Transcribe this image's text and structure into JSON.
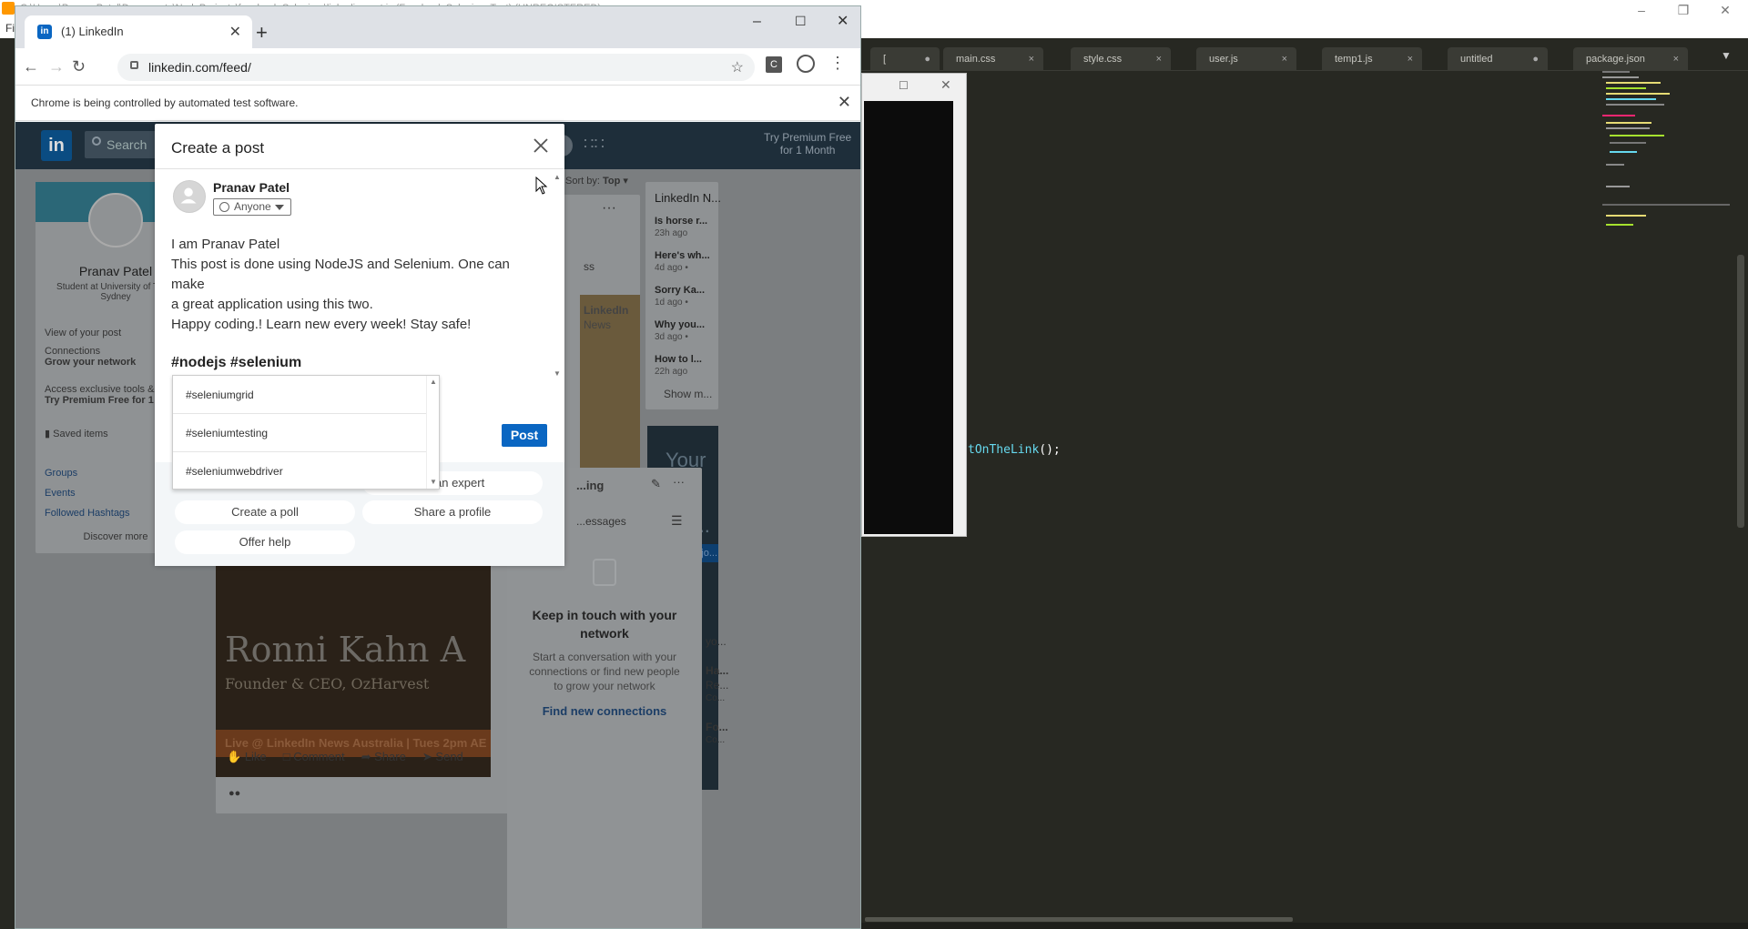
{
  "sublime": {
    "title": "C:\\Users\\Pranav Patel\\Documents\\NodeProjects\\facebook-Selenium\\linkedin-post.js (Facebook Selenium Test) (UNREGISTERED)",
    "menu_letter": "Fi",
    "tabs": [
      {
        "label": "[",
        "close": "●"
      },
      {
        "label": "main.css",
        "close": "×"
      },
      {
        "label": "style.css",
        "close": "×"
      },
      {
        "label": "user.js",
        "close": "×"
      },
      {
        "label": "temp1.js",
        "close": "×"
      },
      {
        "label": "untitled",
        "close": "●"
      },
      {
        "label": "package.json",
        "close": "×"
      }
    ],
    "code_fn": "tOnTheLink",
    "code_rest": "();"
  },
  "chrome": {
    "tab_title": "(1) LinkedIn",
    "tab_icon": "in",
    "url": "linkedin.com/feed/",
    "infobar": "Chrome is being controlled by automated test software."
  },
  "linkedin": {
    "logo": "in",
    "search_placeholder": "Search",
    "notif_count": "1",
    "premium_line1": "Try Premium Free",
    "premium_line2": "for 1 Month",
    "profile": {
      "name": "Pranav Patel",
      "headline": "Student at University of Tec... Sydney",
      "views": "View of your post",
      "connections": "Connections",
      "grow": "Grow your network",
      "access": "Access exclusive tools & in...",
      "premium": "Try Premium Free for 1 M...",
      "saved": "Saved items"
    },
    "left_links": [
      "Groups",
      "Events",
      "Followed Hashtags"
    ],
    "discover": "Discover more",
    "sort": "Sort by:",
    "sort_value": "Top",
    "news_title": "LinkedIn N...",
    "news": [
      {
        "title": "Is horse r...",
        "meta": "23h ago"
      },
      {
        "title": "Here's wh...",
        "meta": "4d ago •"
      },
      {
        "title": "Sorry Ka...",
        "meta": "1d ago •"
      },
      {
        "title": "Why you...",
        "meta": "3d ago •"
      },
      {
        "title": "How to l...",
        "meta": "22h ago"
      }
    ],
    "show_more": "Show m...",
    "feed_fragment": "ss",
    "news_brand": "LinkedIn",
    "news_sub": "News",
    "promo_text": "Your ... o is ... an ... nk...",
    "promo_btn": "ee jo...",
    "hero_name": "Ronni Kahn A",
    "hero_role": "Founder & CEO, OzHarvest",
    "hero_live": "Live @ LinkedIn News Australia | Tues 2pm AE",
    "actions": [
      "Like",
      "Comment",
      "Share",
      "Send"
    ],
    "messaging": "...ing",
    "msg_search": "...essages",
    "keep_title": "Keep in touch with your network",
    "keep_body": "Start a conversation with your connections or find new people to grow your network",
    "find": "Find new connections",
    "side_frag": [
      "yo...",
      "Ha...",
      "Re...",
      "Co...",
      "Fo...",
      "Co..."
    ]
  },
  "modal": {
    "title": "Create a post",
    "author": "Pranav Patel",
    "visibility": "Anyone",
    "body_lines": [
      "I am Pranav Patel",
      "This post is done using NodeJS and Selenium. One can make",
      "a great application using this two.",
      "Happy coding.! Learn new every week! Stay safe!"
    ],
    "hashtags": "#nodejs #selenium",
    "post_button": "Post",
    "footer_pills": [
      "Create a poll",
      "Share a profile",
      "Offer help"
    ],
    "hidden_pill": "an expert",
    "suggestions": [
      "#seleniumgrid",
      "#seleniumtesting",
      "#seleniumwebdriver"
    ]
  },
  "colors": {
    "linkedin_blue": "#0a66c2",
    "editor_bg": "#272822",
    "overlay_dim": "#7b7e80"
  }
}
